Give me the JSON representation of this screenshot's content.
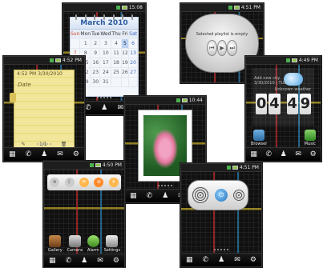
{
  "phones": {
    "calendar": {
      "time": "15:08",
      "title": "March 2010",
      "weekdays": [
        "Sun",
        "Mon",
        "Tue",
        "Wed",
        "Thu",
        "Fri",
        "Sat"
      ],
      "rows": [
        [
          "",
          "1",
          "2",
          "3",
          "4",
          "5",
          "6"
        ],
        [
          "7",
          "8",
          "9",
          "10",
          "11",
          "12",
          "13"
        ],
        [
          "14",
          "15",
          "16",
          "17",
          "18",
          "19",
          "20"
        ],
        [
          "21",
          "22",
          "23",
          "24",
          "25",
          "26",
          "27"
        ],
        [
          "28",
          "29",
          "30",
          "31",
          "",
          "",
          ""
        ]
      ],
      "today": "5"
    },
    "notes": {
      "time": "4:52 PM",
      "date_time": "4:52 PM 3/30/2010",
      "label": "Date",
      "page": "1/1"
    },
    "music": {
      "time": "4:51 PM",
      "message": "Selected playlist is empty"
    },
    "clock": {
      "time": "4:49 PM",
      "city": "Add new city",
      "sub": "3/30/2010 | TUE",
      "unknown": "Unknown weather",
      "h1": "0",
      "h2": "4",
      "m1": "4",
      "m2": "9",
      "apps": [
        "Browser",
        "Music"
      ]
    },
    "photo": {
      "time": "10:44"
    },
    "settings": {
      "time": "4:50 PM",
      "apps": [
        "Gallery",
        "Camera",
        "Alarm",
        "Settings"
      ]
    },
    "speaker": {
      "time": "4:51 PM"
    }
  },
  "dock": {
    "icons": [
      "grid-icon",
      "phone-icon",
      "contacts-icon",
      "message-icon",
      "settings-icon"
    ]
  }
}
